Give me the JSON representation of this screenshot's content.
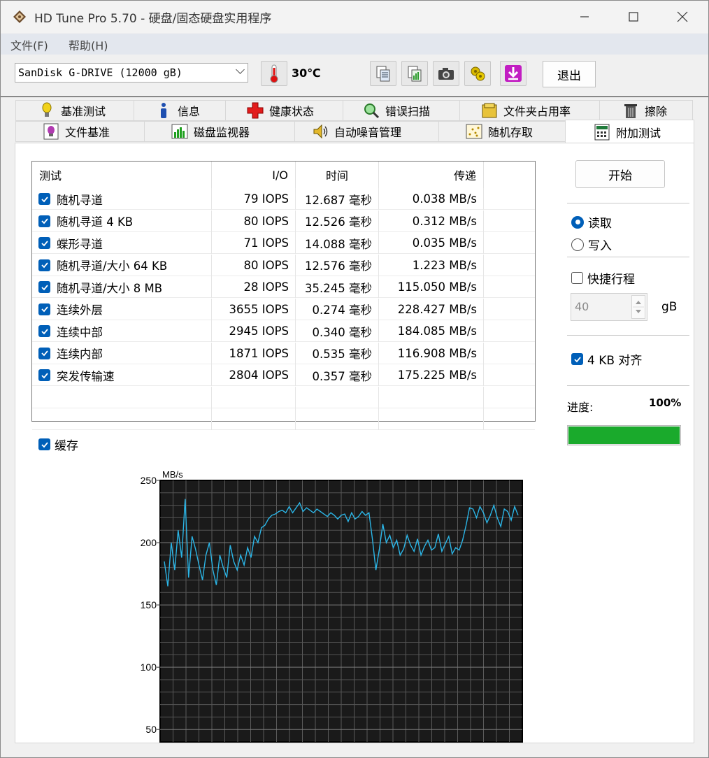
{
  "window": {
    "title": "HD Tune Pro 5.70 - 硬盘/固态硬盘实用程序",
    "minimize_icon": "minimize-icon",
    "maximize_icon": "maximize-icon",
    "close_icon": "close-icon"
  },
  "menu": {
    "items": [
      {
        "label": "文件(F)"
      },
      {
        "label": "帮助(H)"
      }
    ]
  },
  "toolbar": {
    "drive": "SanDisk G-DRIVE (12000 gB)",
    "temperature": "30℃",
    "exit_label": "退出",
    "buttons": [
      "copy-text-icon",
      "copy-screenshot-icon",
      "camera-icon",
      "options-icon",
      "save-download-icon"
    ]
  },
  "tabs_row1": [
    {
      "label": "基准测试",
      "icon": "bulb-icon"
    },
    {
      "label": "信息",
      "icon": "info-icon"
    },
    {
      "label": "健康状态",
      "icon": "health-cross-icon"
    },
    {
      "label": "错误扫描",
      "icon": "magnifier-icon"
    },
    {
      "label": "文件夹占用率",
      "icon": "folder-icon"
    },
    {
      "label": "擦除",
      "icon": "trash-icon"
    }
  ],
  "tabs_row2": [
    {
      "label": "文件基准",
      "icon": "file-bulb-icon"
    },
    {
      "label": "磁盘监视器",
      "icon": "monitor-chart-icon"
    },
    {
      "label": "自动噪音管理",
      "icon": "speaker-icon"
    },
    {
      "label": "随机存取",
      "icon": "scatter-icon"
    },
    {
      "label": "附加测试",
      "icon": "calculator-icon",
      "active": true
    }
  ],
  "table": {
    "headers": [
      "测试",
      "I/O",
      "时间",
      "传递"
    ],
    "rows": [
      {
        "name": "随机寻道",
        "io": "79 IOPS",
        "time": "12.687 毫秒",
        "rate": "0.038 MB/s"
      },
      {
        "name": "随机寻道 4 KB",
        "io": "80 IOPS",
        "time": "12.526 毫秒",
        "rate": "0.312 MB/s"
      },
      {
        "name": "蝶形寻道",
        "io": "71 IOPS",
        "time": "14.088 毫秒",
        "rate": "0.035 MB/s"
      },
      {
        "name": "随机寻道/大小 64 KB",
        "io": "80 IOPS",
        "time": "12.576 毫秒",
        "rate": "1.223 MB/s"
      },
      {
        "name": "随机寻道/大小 8 MB",
        "io": "28 IOPS",
        "time": "35.245 毫秒",
        "rate": "115.050 MB/s"
      },
      {
        "name": "连续外层",
        "io": "3655 IOPS",
        "time": "0.274 毫秒",
        "rate": "228.427 MB/s"
      },
      {
        "name": "连续中部",
        "io": "2945 IOPS",
        "time": "0.340 毫秒",
        "rate": "184.085 MB/s"
      },
      {
        "name": "连续内部",
        "io": "1871 IOPS",
        "time": "0.535 毫秒",
        "rate": "116.908 MB/s"
      },
      {
        "name": "突发传输速",
        "io": "2804 IOPS",
        "time": "0.357 毫秒",
        "rate": "175.225 MB/s"
      }
    ]
  },
  "controls": {
    "start_label": "开始",
    "read_label": "读取",
    "write_label": "写入",
    "mode_selected": "read",
    "short_stroke_label": "快捷行程",
    "short_stroke_checked": false,
    "short_stroke_value": "40",
    "short_stroke_unit": "gB",
    "align_label": "4 KB 对齐",
    "align_checked": true,
    "progress_label": "进度:",
    "progress_text": "100%",
    "progress_value": 1.0,
    "cache_label": "缓存",
    "cache_checked": true
  },
  "colors": {
    "accent": "#005fb8",
    "progress": "#1aaa2c",
    "chart_bg": "#1a1a1a",
    "chart_line": "#2bb5e6"
  },
  "chart_data": {
    "type": "line",
    "ylabel": "MB/s",
    "ylim": [
      40,
      250
    ],
    "yticks": [
      50,
      100,
      150,
      200,
      250
    ],
    "grid": true,
    "series": [
      {
        "values": [
          185,
          165,
          200,
          178,
          210,
          188,
          235,
          172,
          205,
          195,
          182,
          170,
          190,
          200,
          178,
          166,
          190,
          180,
          172,
          198,
          185,
          178,
          190,
          182,
          196,
          188,
          205,
          200,
          212,
          214,
          219,
          222,
          223,
          225,
          226,
          224,
          229,
          224,
          228,
          232,
          225,
          228,
          226,
          224,
          227,
          225,
          223,
          221,
          224,
          222,
          219,
          222,
          223,
          217,
          224,
          219,
          221,
          225,
          222,
          224,
          203,
          178,
          195,
          215,
          200,
          206,
          196,
          202,
          190,
          195,
          206,
          198,
          193,
          203,
          190,
          197,
          202,
          194,
          196,
          207,
          193,
          199,
          205,
          191,
          196,
          194,
          202,
          214,
          228,
          227,
          220,
          229,
          224,
          216,
          222,
          230,
          220,
          213,
          227,
          225,
          218,
          229,
          222
        ]
      }
    ]
  }
}
